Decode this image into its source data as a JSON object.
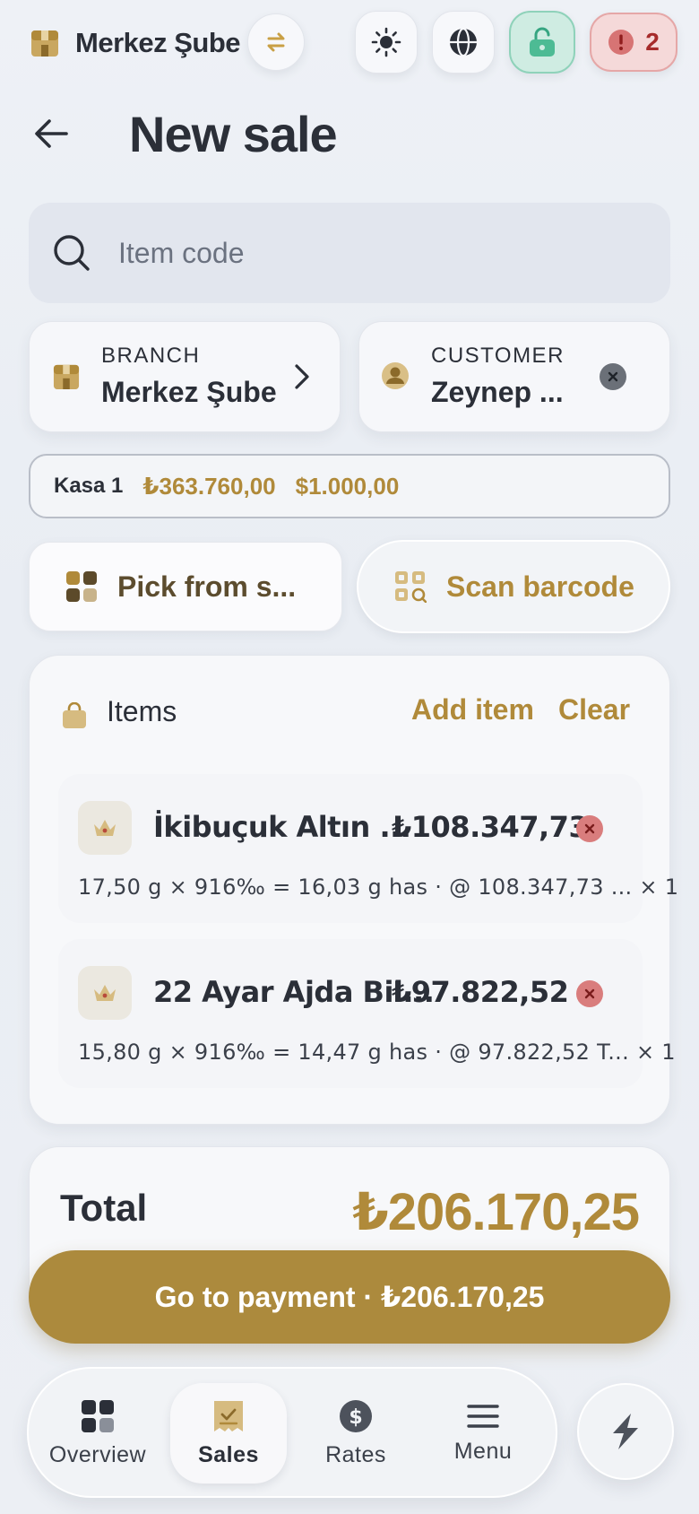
{
  "header": {
    "branch_name": "Merkez Şube",
    "alert_count": "2",
    "page_title": "New sale"
  },
  "search": {
    "placeholder": "Item code"
  },
  "branch_card": {
    "label": "BRANCH",
    "value": "Merkez Şube"
  },
  "customer_card": {
    "label": "CUSTOMER",
    "value": "Zeynep ..."
  },
  "register": {
    "name": "Kasa 1",
    "try_balance": "₺363.760,00",
    "usd_balance": "$1.000,00"
  },
  "actions": {
    "pick_label": "Pick from s...",
    "scan_label": "Scan barcode"
  },
  "items_section": {
    "title": "Items",
    "add_label": "Add item",
    "clear_label": "Clear",
    "rows": [
      {
        "name": "İkibuçuk Altın ...",
        "price": "₺108.347,73",
        "detail": "17,50 g × 916‰ = 16,03 g has · @ 108.347,73 ... × 1"
      },
      {
        "name": "22 Ayar Ajda Bil...",
        "price": "₺97.822,52",
        "detail": "15,80 g × 916‰ = 14,47 g has · @ 97.822,52 T... × 1"
      }
    ]
  },
  "total": {
    "label": "Total",
    "value": "₺206.170,25"
  },
  "pay_button": {
    "label": "Go to payment · ₺206.170,25"
  },
  "nav": {
    "items": [
      {
        "label": "Overview",
        "icon": "grid-icon"
      },
      {
        "label": "Sales",
        "icon": "receipt-icon",
        "active": true
      },
      {
        "label": "Rates",
        "icon": "dollar-icon"
      },
      {
        "label": "Menu",
        "icon": "menu-icon"
      }
    ]
  },
  "colors": {
    "accent_gold": "#b08a3a",
    "button_gold": "#ac8a3d",
    "lock_green": "#cfece2",
    "alert_red": "#f5d9d9"
  }
}
